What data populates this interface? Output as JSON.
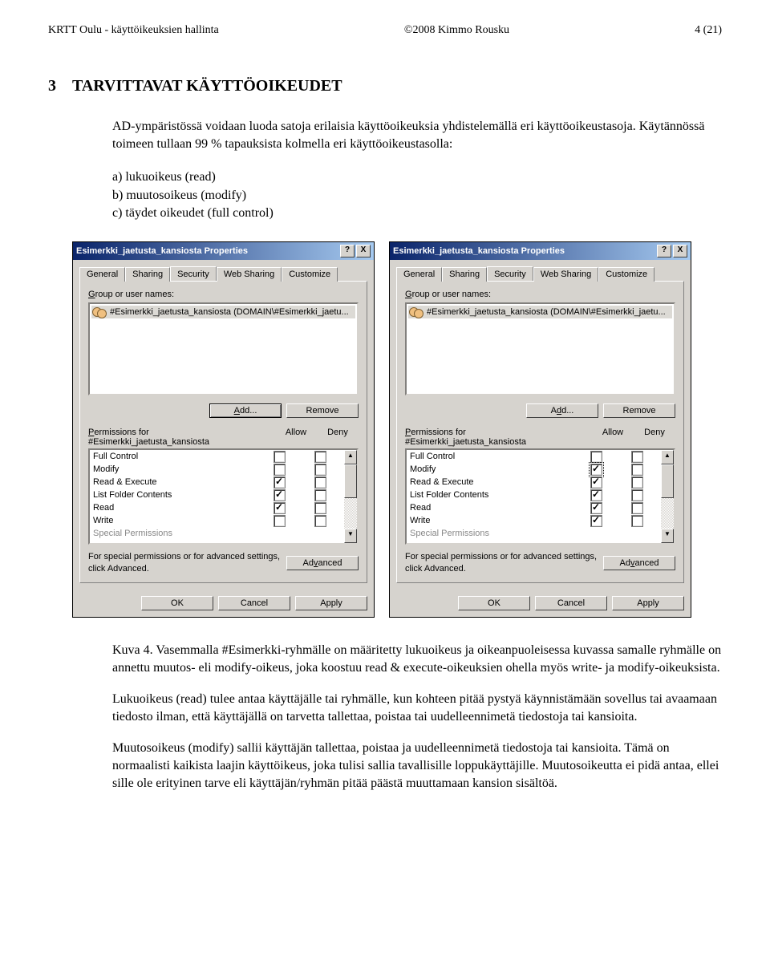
{
  "header": {
    "left": "KRTT Oulu - käyttöikeuksien hallinta",
    "center": "©2008 Kimmo Rousku",
    "right": "4 (21)"
  },
  "section": {
    "number": "3",
    "title": "TARVITTAVAT KÄYTTÖOIKEUDET"
  },
  "intro": "AD-ympäristössä voidaan luoda satoja erilaisia käyttöoikeuksia yhdistelemällä eri käyttöoikeustasoja. Käytännössä toimeen tullaan 99 % tapauksista kolmella eri käyttöoikeustasolla:",
  "list": {
    "a": "a)   lukuoikeus (read)",
    "b": "b)   muutosoikeus (modify)",
    "c": "c)   täydet oikeudet (full control)"
  },
  "dialog": {
    "title": "Esimerkki_jaetusta_kansiosta Properties",
    "helpBtn": "?",
    "closeBtn": "X",
    "tabs": {
      "general": "General",
      "sharing": "Sharing",
      "security": "Security",
      "websharing": "Web Sharing",
      "customize": "Customize"
    },
    "groupLabelPre": "G",
    "groupLabelRest": "roup or user names:",
    "groupEntry": "#Esimerkki_jaetusta_kansiosta (DOMAIN\\#Esimerkki_jaetu...",
    "addBtn": "Add...",
    "removeBtn": "Remove",
    "permForPre": "P",
    "permForRest": "ermissions for",
    "permForName": "#Esimerkki_jaetusta_kansiosta",
    "allow": "Allow",
    "deny": "Deny",
    "perms": {
      "full": "Full Control",
      "modify": "Modify",
      "readexec": "Read & Execute",
      "listfolder": "List Folder Contents",
      "read": "Read",
      "write": "Write",
      "special": "Special Permissions"
    },
    "specialText": "For special permissions or for advanced settings, click Advanced.",
    "advancedBtn": "Advanced",
    "ok": "OK",
    "cancel": "Cancel",
    "apply": "Apply"
  },
  "caption": {
    "p1": "Kuva 4. Vasemmalla #Esimerkki-ryhmälle on määritetty lukuoikeus ja oikeanpuoleisessa kuvassa samalle ryhmälle on annettu muutos- eli modify-oikeus, joka koostuu read & execute-oikeuksien ohella myös write- ja modify-oikeuksista.",
    "p2": "Lukuoikeus (read) tulee antaa käyttäjälle tai ryhmälle, kun kohteen pitää pystyä käynnistämään sovellus tai avaamaan tiedosto ilman, että käyttäjällä on tarvetta tallettaa, poistaa tai uudelleennimetä tiedostoja tai kansioita.",
    "p3": "Muutosoikeus (modify) sallii käyttäjän tallettaa, poistaa ja uudelleennimetä tiedostoja tai kansioita. Tämä on normaalisti kaikista laajin käyttöikeus, joka tulisi sallia tavallisille loppukäyttäjille. Muutosoikeutta ei pidä antaa, ellei sille ole erityinen tarve eli käyttäjän/ryhmän pitää päästä muuttamaan kansion sisältöä."
  },
  "left_perms": {
    "full": false,
    "modify": false,
    "readexec": true,
    "listfolder": true,
    "read": true,
    "write": false
  },
  "right_perms": {
    "full": false,
    "modify": true,
    "readexec": true,
    "listfolder": true,
    "read": true,
    "write": true
  }
}
